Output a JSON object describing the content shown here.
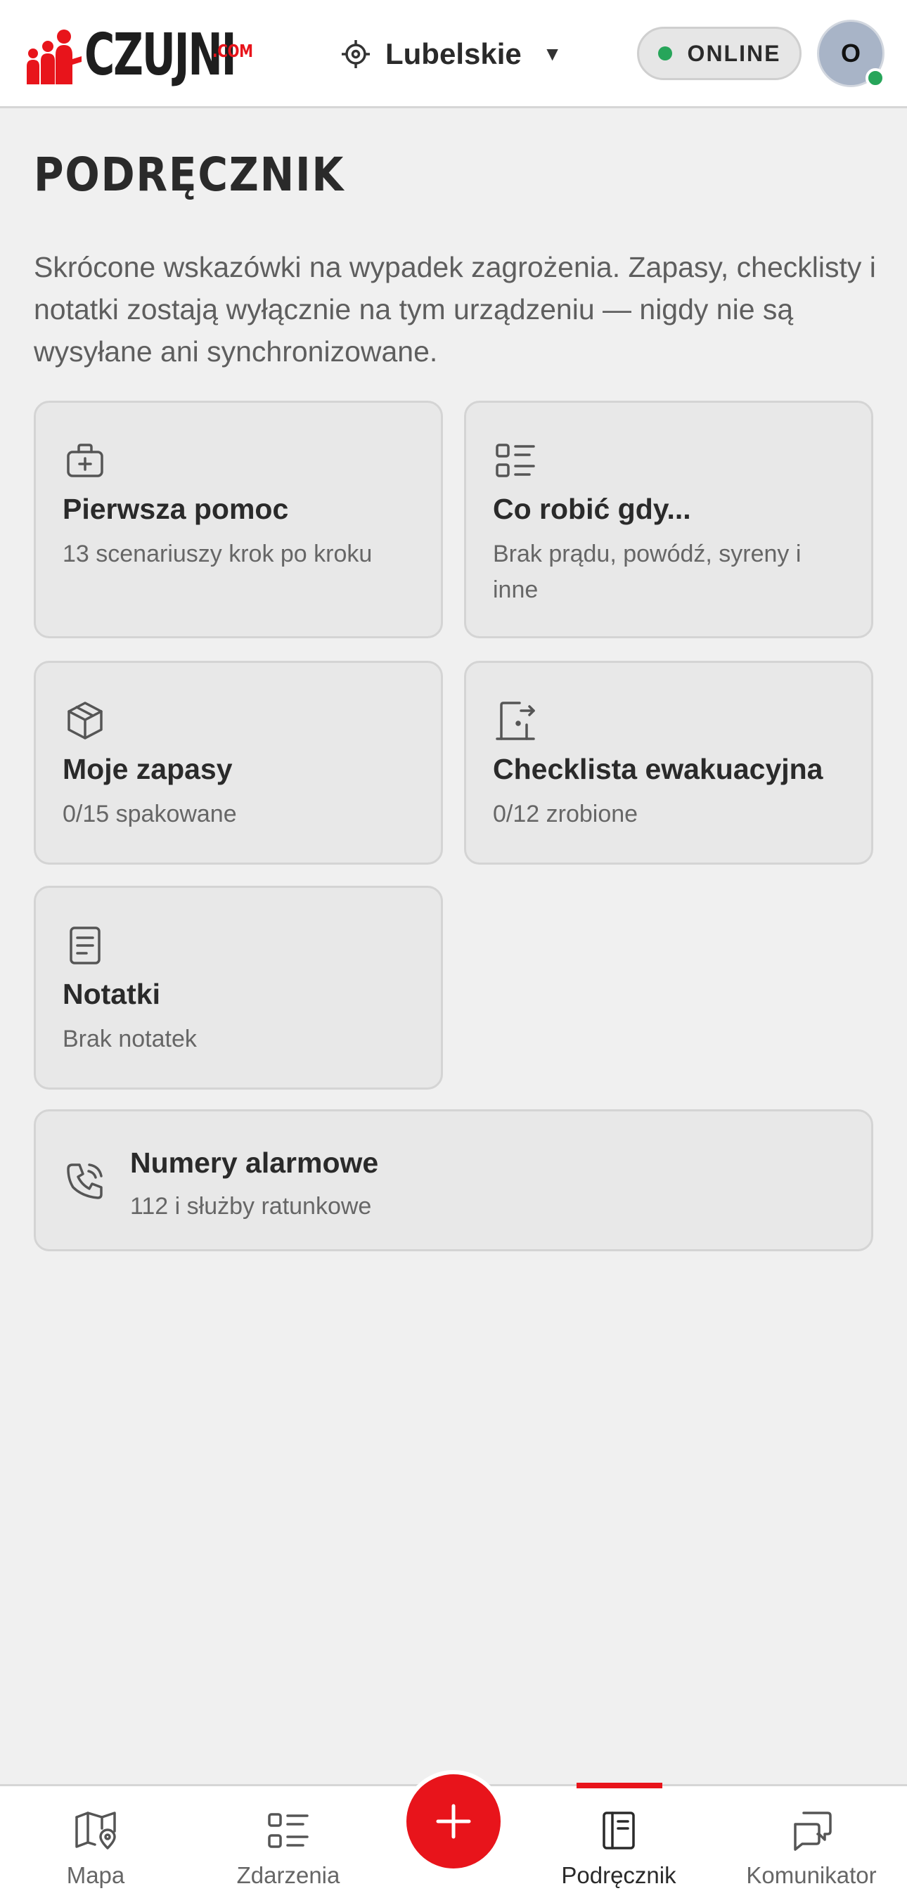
{
  "header": {
    "logo_text": "CZUJNI",
    "logo_suffix": ".COM",
    "region": "Lubelskie",
    "status": "ONLINE",
    "avatar_initial": "O"
  },
  "main": {
    "title": "PODRĘCZNIK",
    "intro": "Skrócone wskazówki na wypadek zagrożenia. Zapasy, checklisty i notatki zostają wyłącznie na tym urządzeniu — nigdy nie są wysyłane ani synchronizowane.",
    "cards": [
      {
        "title": "Pierwsza pomoc",
        "subtitle": "13 scenariuszy krok po kroku",
        "icon": "first-aid-kit-icon"
      },
      {
        "title": "Co robić gdy...",
        "subtitle": "Brak prądu, powódź, syreny i inne",
        "icon": "list-icon"
      },
      {
        "title": "Moje zapasy",
        "subtitle": "0/15 spakowane",
        "icon": "package-icon"
      },
      {
        "title": "Checklista ewakuacyjna",
        "subtitle": "0/12 zrobione",
        "icon": "door-exit-icon"
      },
      {
        "title": "Notatki",
        "subtitle": "Brak notatek",
        "icon": "note-icon"
      }
    ],
    "emergency": {
      "title": "Numery alarmowe",
      "subtitle": "112 i służby ratunkowe",
      "icon": "phone-icon"
    }
  },
  "nav": {
    "items": [
      {
        "label": "Mapa",
        "icon": "map-icon"
      },
      {
        "label": "Zdarzenia",
        "icon": "list-icon"
      },
      {
        "label": "Podręcznik",
        "icon": "book-icon",
        "active": true
      },
      {
        "label": "Komunikator",
        "icon": "chat-icon"
      }
    ],
    "fab_icon": "plus-icon"
  },
  "colors": {
    "accent": "#e8141b",
    "online": "#27a55a",
    "background": "#f0f0f0",
    "card": "#e8e8e8"
  }
}
